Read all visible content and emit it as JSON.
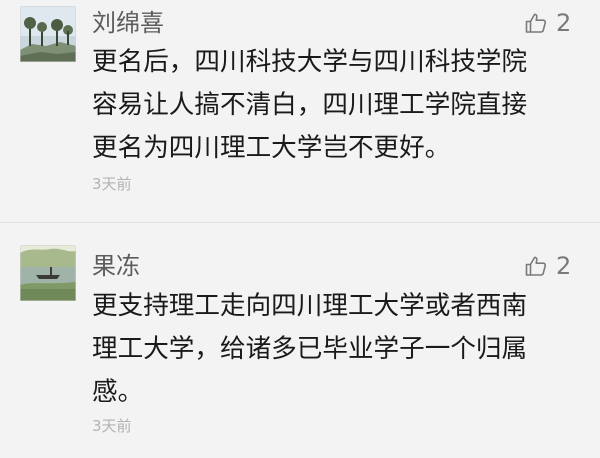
{
  "comments": [
    {
      "author": "刘绵喜",
      "likes": "2",
      "lines": [
        "更名后，四川科技大学与四川科技学院",
        "容易让人搞不清白，四川理工学院直接",
        "更名为四川理工大学岂不更好。"
      ],
      "time": "3天前",
      "avatar_icon": "landscape-trees-avatar",
      "like_icon": "thumbs-up-icon"
    },
    {
      "author": "果冻",
      "likes": "2",
      "lines": [
        "更支持理工走向四川理工大学或者西南",
        "理工大学，给诸多已毕业学子一个归属",
        "感。"
      ],
      "time": "3天前",
      "avatar_icon": "lake-boat-avatar",
      "like_icon": "thumbs-up-icon"
    }
  ],
  "colors": {
    "background": "#f3f3f3",
    "author": "#5c5c5c",
    "body_text": "#1a1a1a",
    "timestamp": "#b3b3b3",
    "like": "#7a7a7a"
  }
}
